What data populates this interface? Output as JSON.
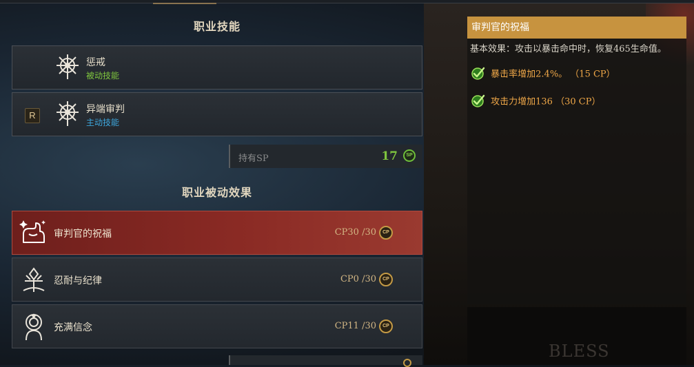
{
  "skills_section": {
    "title": "职业技能",
    "skills": [
      {
        "name": "惩戒",
        "type": "被动技能",
        "icon": "seal-icon"
      },
      {
        "name": "异端审判",
        "type": "主动技能",
        "key": "R",
        "icon": "seal-icon"
      }
    ],
    "sp": {
      "label": "持有SP",
      "value": "17",
      "badge": "SP"
    }
  },
  "passive_section": {
    "title": "职业被动效果",
    "items": [
      {
        "name": "审判官的祝福",
        "cp": "CP30 /30",
        "icon": "flex-arm-icon",
        "selected": true
      },
      {
        "name": "忍耐与纪律",
        "cp": "CP0 /30",
        "icon": "cross-emblem-icon",
        "selected": false
      },
      {
        "name": "充满信念",
        "cp": "CP11 /30",
        "icon": "halo-figure-icon",
        "selected": false
      }
    ],
    "cp_badge": "CP"
  },
  "detail": {
    "title": "审判官的祝福",
    "base_effect": "基本效果：攻击以暴击命中时，恢复465生命值。",
    "effects": [
      {
        "text": "暴击率增加2.4%。 （15 CP）"
      },
      {
        "text": "攻击力增加136 （30 CP）"
      }
    ]
  },
  "watermark": "BLESS",
  "colors": {
    "passive": "#7fc63e",
    "active": "#3ea7dd",
    "selected": "#8a2a24",
    "header": "#c7933f",
    "effect": "#f0a848"
  }
}
